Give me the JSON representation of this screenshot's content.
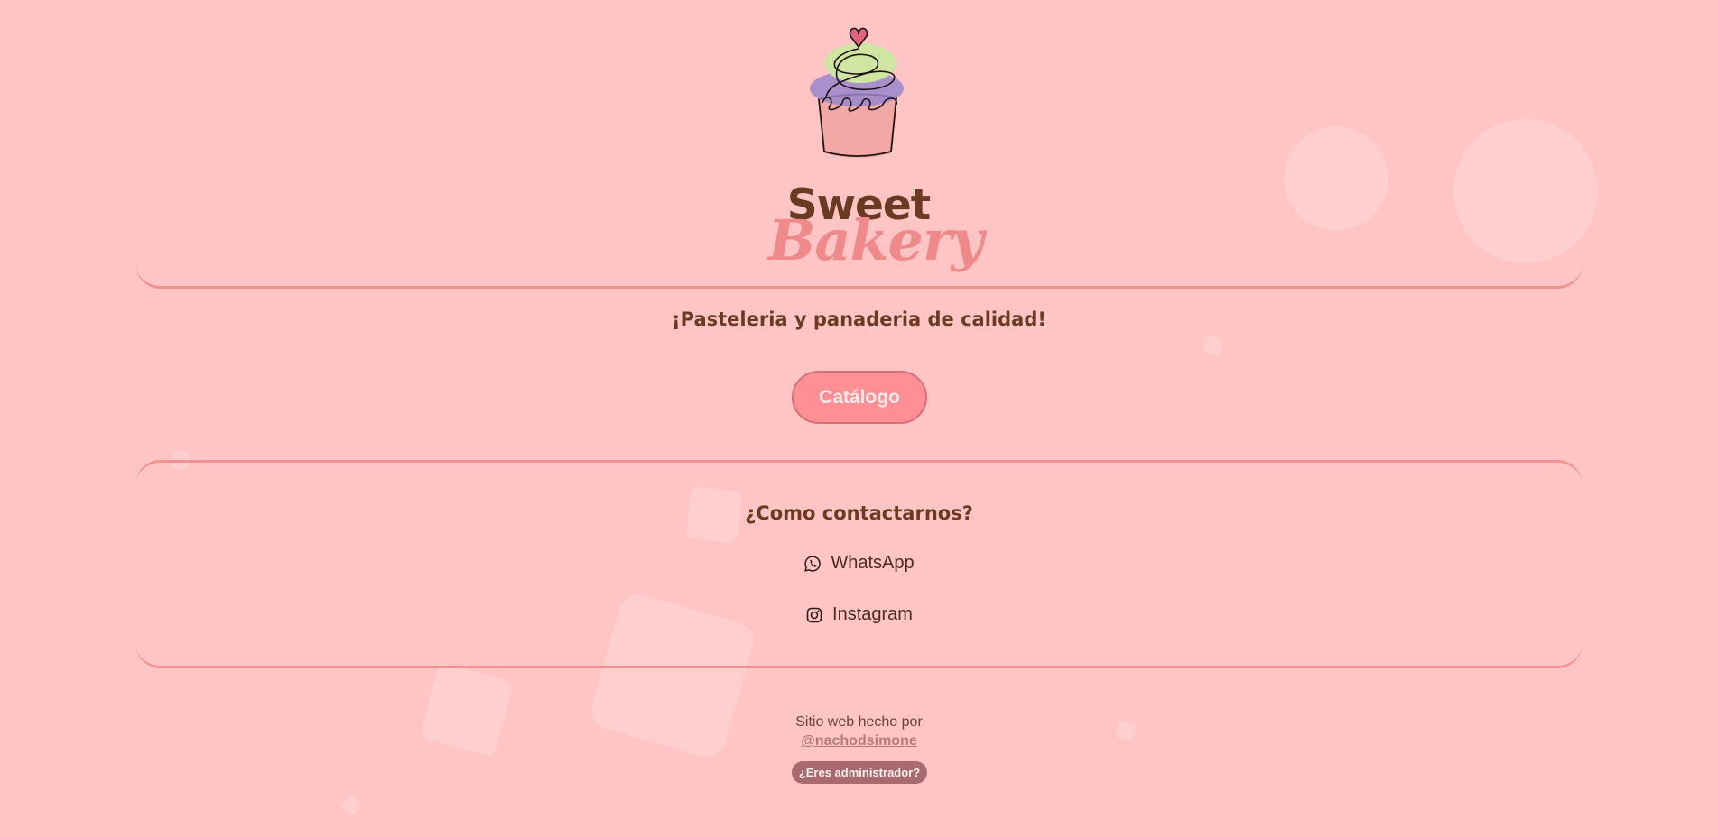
{
  "brand": {
    "name_line1": "Sweet",
    "name_line2": "Bakery",
    "logo_icon": "cupcake-icon",
    "colors": {
      "background": "#ffc4c4",
      "brown": "#6b3a22",
      "pink_accent": "#f08a8a",
      "rule": "#f39090"
    }
  },
  "hero": {
    "tagline": "¡Pasteleria y panaderia de calidad!",
    "catalog_button": "Catálogo"
  },
  "contact": {
    "title": "¿Como contactarnos?",
    "links": [
      {
        "label": "WhatsApp",
        "icon": "whatsapp-icon"
      },
      {
        "label": "Instagram",
        "icon": "instagram-icon"
      }
    ]
  },
  "footer": {
    "made_by": "Sitio web hecho por",
    "author": "@nachodsimone",
    "admin_button": "¿Eres administrador?"
  }
}
